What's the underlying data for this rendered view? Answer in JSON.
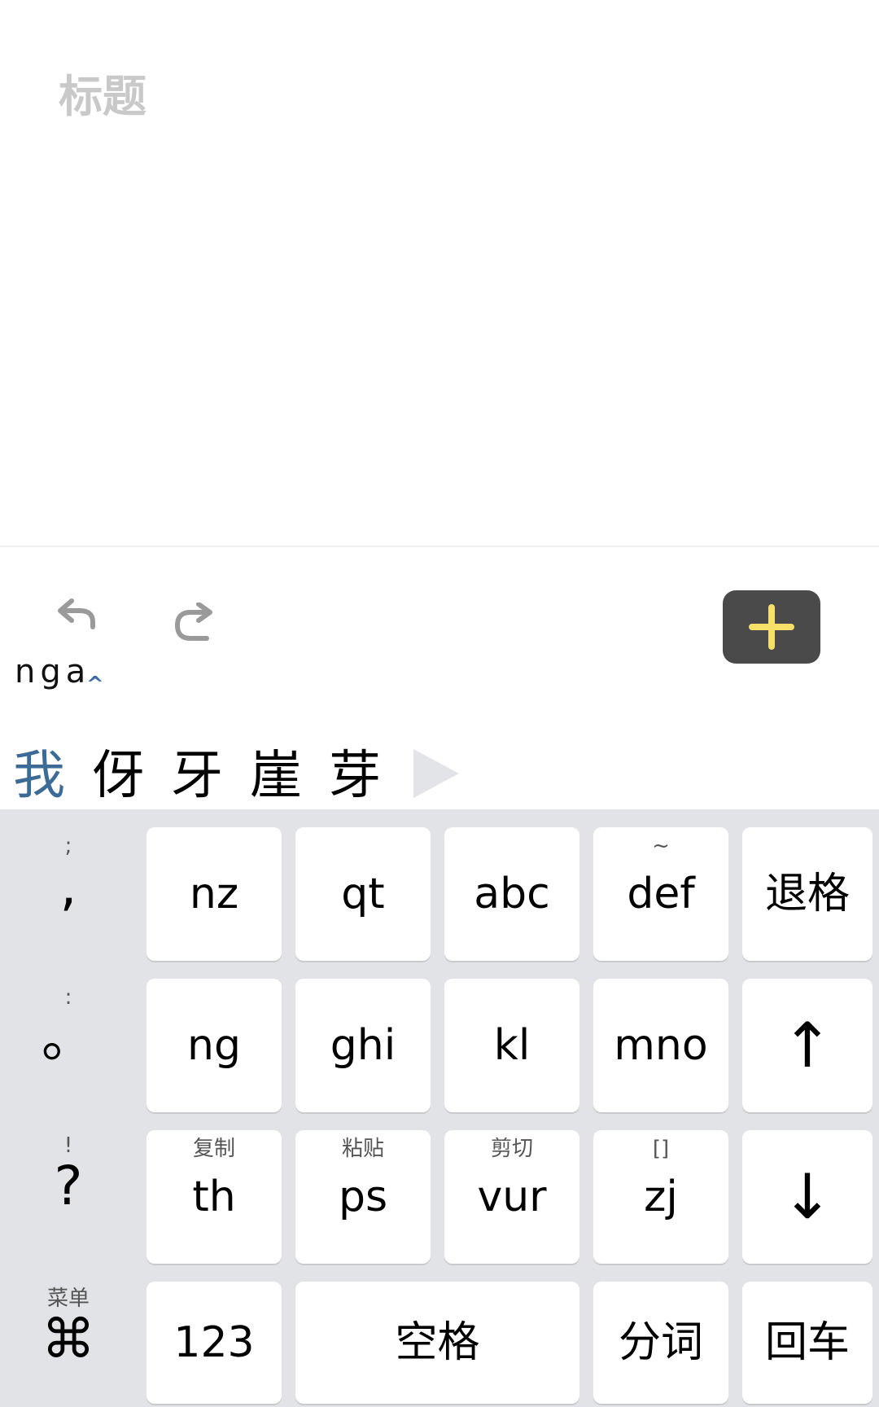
{
  "editor": {
    "title_placeholder": "标题"
  },
  "toolbar": {
    "undo_icon": "undo-icon",
    "redo_icon": "redo-icon",
    "add_icon": "plus-icon",
    "add_icon_color": "#f7e06a",
    "add_bg": "#4a4a4a"
  },
  "ime": {
    "composing": "nga",
    "caret": "^",
    "candidates": [
      "我",
      "伢",
      "牙",
      "崖",
      "芽"
    ],
    "more_icon": "triangle-right-icon"
  },
  "keyboard": {
    "punct": [
      {
        "sub": ";",
        "main": ","
      },
      {
        "sub": ":",
        "main": "。"
      },
      {
        "sub": "!",
        "main": "?"
      },
      {
        "sub": "菜单",
        "main": "⌘"
      }
    ],
    "row1": [
      {
        "sub": "",
        "main": "nz"
      },
      {
        "sub": "",
        "main": "qt"
      },
      {
        "sub": "",
        "main": "abc"
      },
      {
        "sub": "~",
        "main": "def"
      },
      {
        "sub": "",
        "main": "退格"
      }
    ],
    "row2": [
      {
        "sub": "",
        "main": "ng"
      },
      {
        "sub": "",
        "main": "ghi"
      },
      {
        "sub": "",
        "main": "kl"
      },
      {
        "sub": "",
        "main": "mno"
      },
      {
        "sub": "",
        "main": "↑"
      }
    ],
    "row3": [
      {
        "sub": "复制",
        "main": "th"
      },
      {
        "sub": "粘贴",
        "main": "ps"
      },
      {
        "sub": "剪切",
        "main": "vur"
      },
      {
        "sub": "[]",
        "main": "zj"
      },
      {
        "sub": "",
        "main": "↓"
      }
    ],
    "row4": [
      {
        "main": "123"
      },
      {
        "main": "空格"
      },
      {
        "main": "分词"
      },
      {
        "main": "回车"
      }
    ]
  }
}
